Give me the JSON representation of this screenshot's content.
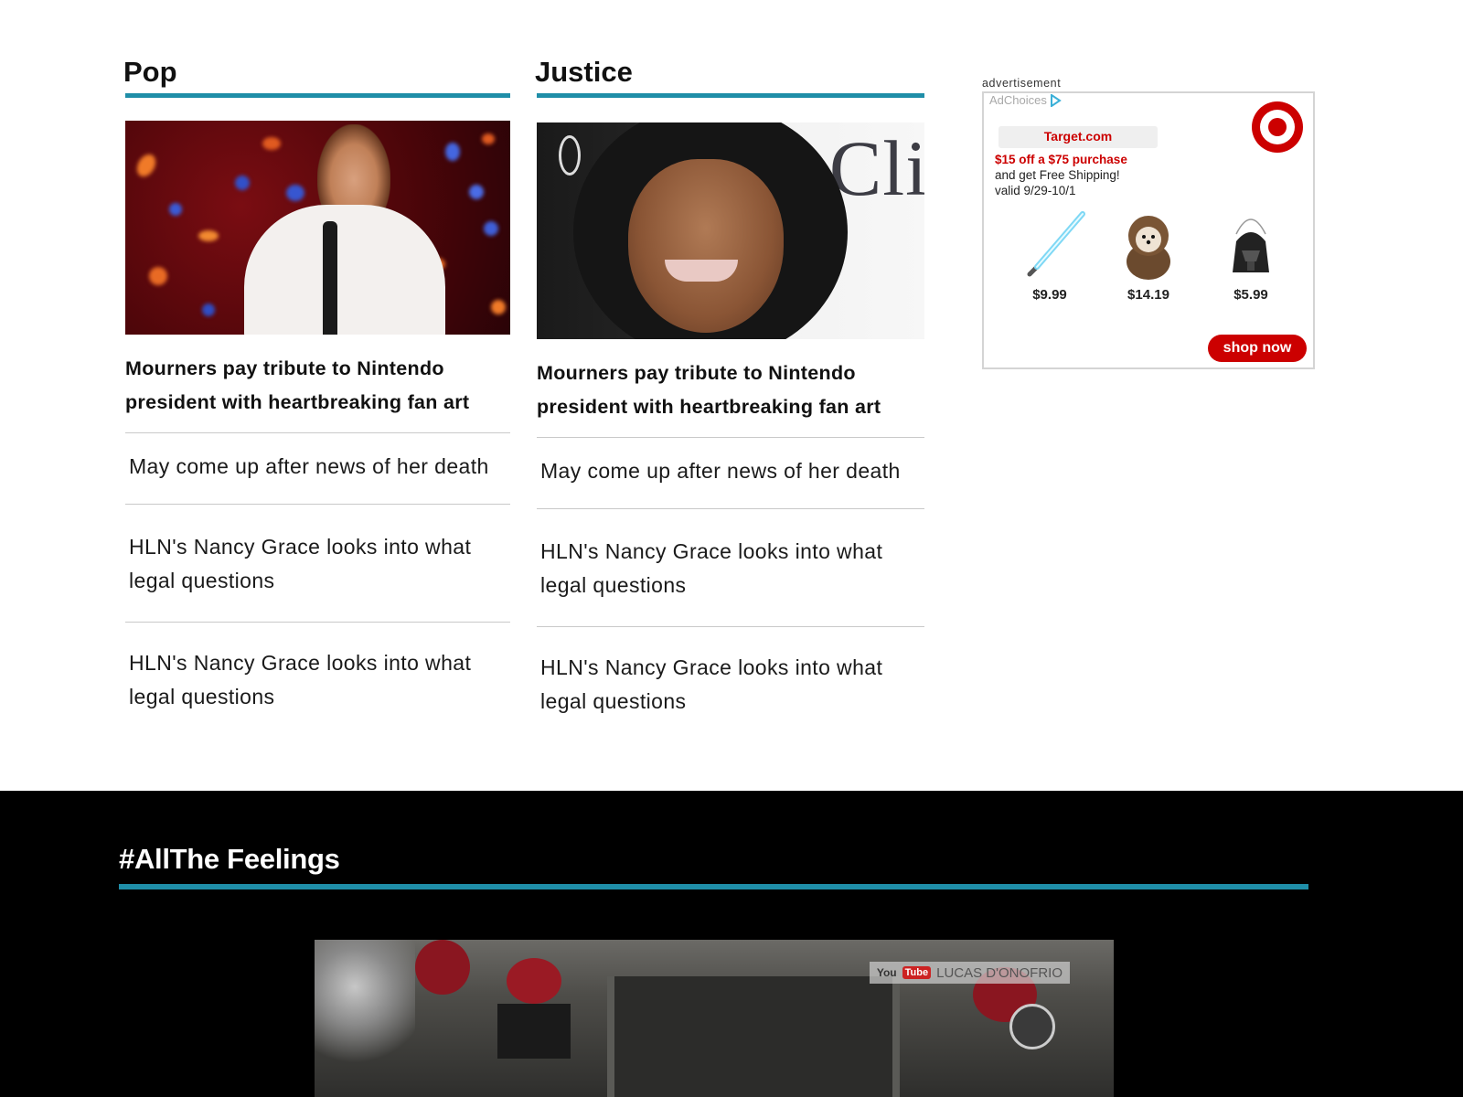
{
  "sections": {
    "pop": {
      "title": "Pop",
      "lead_headline": "Mourners pay tribute to Nintendo president with heartbreaking fan art",
      "stories": [
        "May come up after news of her death",
        "HLN's Nancy Grace looks into what legal questions",
        "HLN's Nancy Grace looks into what legal questions"
      ]
    },
    "justice": {
      "title": "Justice",
      "lead_headline": "Mourners pay tribute to Nintendo president with heartbreaking fan art",
      "image_text": "Cli",
      "stories": [
        "May come up after news of her death",
        "HLN's Nancy Grace looks into what legal questions",
        "HLN's Nancy Grace looks into what legal questions"
      ]
    }
  },
  "ad": {
    "label": "advertisement",
    "adchoices": "AdChoices",
    "brand": "Target.com",
    "offer_line1": "$15 off a $75 purchase",
    "offer_line2": "and get Free Shipping!",
    "offer_line3": "valid 9/29-10/1",
    "products": [
      {
        "name": "lightsaber-icon",
        "price": "$9.99"
      },
      {
        "name": "ewok-dog-costume-icon",
        "price": "$14.19"
      },
      {
        "name": "darth-vader-bucket-icon",
        "price": "$5.99"
      }
    ],
    "cta": "shop now",
    "brand_color": "#cc0000"
  },
  "feelings": {
    "title": "#AllThe Feelings",
    "video_badge_you": "You",
    "video_badge_tube": "Tube",
    "video_badge_channel": "LUCAS D'ONOFRIO"
  },
  "colors": {
    "accent": "#1f8ea8",
    "dark_bg": "#000000"
  }
}
